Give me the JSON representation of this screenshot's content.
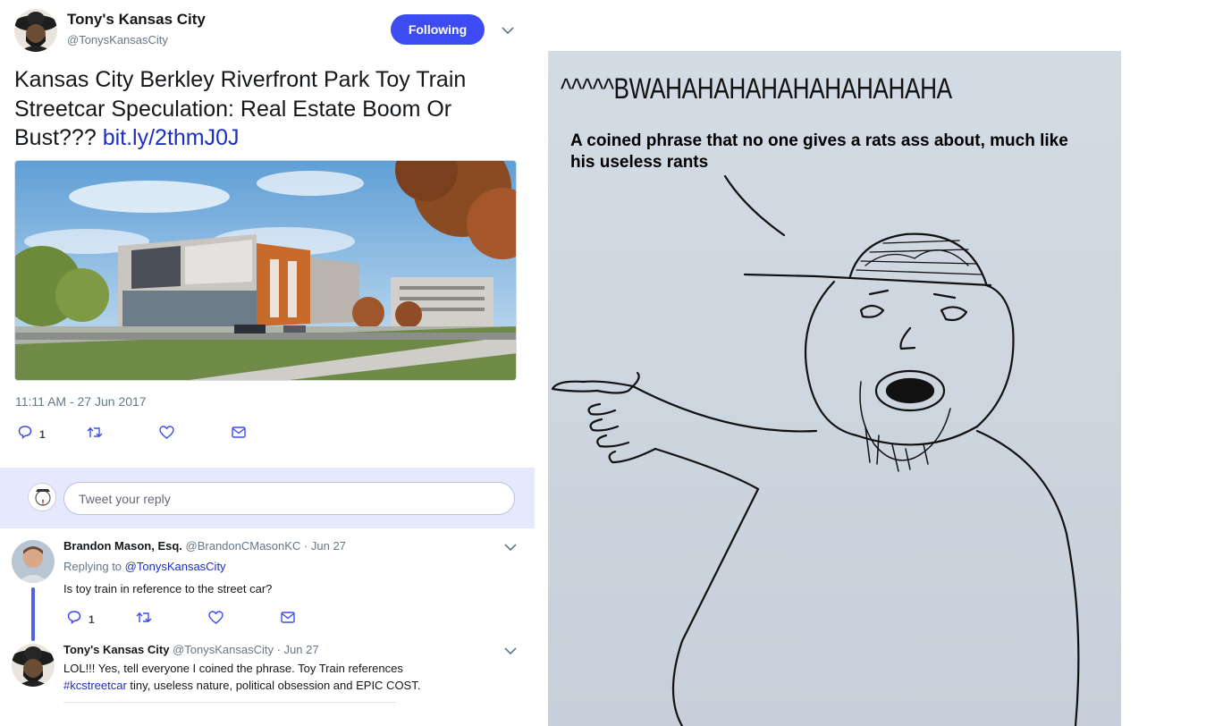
{
  "tweet": {
    "author_name": "Tony's Kansas City",
    "author_handle": "@TonysKansasCity",
    "follow_button": "Following",
    "text_main": "Kansas City Berkley Riverfront Park Toy Train Streetcar Speculation: Real Estate Boom Or Bust??? ",
    "text_link": "bit.ly/2thmJ0J",
    "timestamp": "11:11 AM - 27 Jun 2017",
    "reply_count": "1"
  },
  "reply_box": {
    "placeholder": "Tweet your reply"
  },
  "replies": [
    {
      "author_name": "Brandon Mason, Esq.",
      "meta": " @BrandonCMasonKC · Jun 27",
      "replying_prefix": "Replying to ",
      "replying_to": "@TonysKansasCity",
      "text": "Is toy train in reference to the street car?",
      "reply_count": "1"
    },
    {
      "author_name": "Tony's Kansas City",
      "meta": " @TonysKansasCity · Jun 27",
      "text_part1": "LOL!!! Yes, tell everyone I coined the phrase. Toy Train references ",
      "hashtag": "#kcstreetcar",
      "text_part2": " tiny, useless nature, political obsession and EPIC COST."
    }
  ],
  "meme": {
    "laugh_text": "^^^^^BWAHAHAHAHAHAHAHAHAHA",
    "caption": "A coined phrase that no one gives a rats ass about, much like his useless rants"
  },
  "colors": {
    "follow_button": "#3d4cf2",
    "link": "#1c2fc2",
    "reply_box_bg": "#e6e8fd",
    "meme_bg": "#cdd6df"
  },
  "icons": [
    "chevron-down-icon",
    "reply-icon",
    "retweet-icon",
    "like-icon",
    "message-icon"
  ]
}
